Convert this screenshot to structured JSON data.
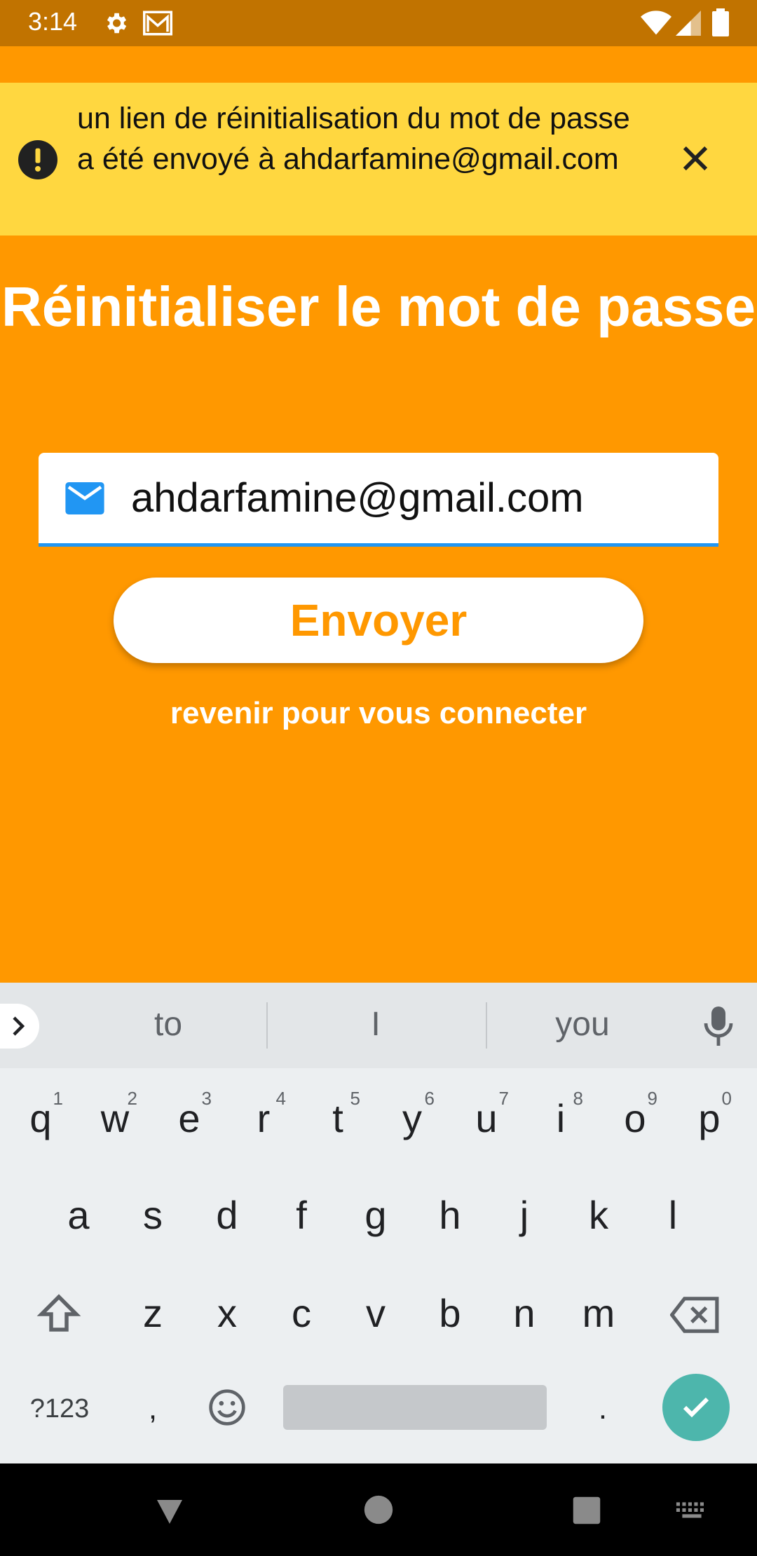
{
  "status_bar": {
    "time": "3:14"
  },
  "banner": {
    "message": "un lien de réinitialisation du mot de passe a été envoyé à ahdarfamine@gmail.com"
  },
  "title": "Réinitialiser le mot de passe",
  "email": {
    "value": "ahdarfamine@gmail.com"
  },
  "send_button": "Envoyer",
  "back_link": "revenir pour vous connecter",
  "keyboard": {
    "suggestions": [
      "to",
      "I",
      "you"
    ],
    "row1": [
      {
        "key": "q",
        "hint": "1"
      },
      {
        "key": "w",
        "hint": "2"
      },
      {
        "key": "e",
        "hint": "3"
      },
      {
        "key": "r",
        "hint": "4"
      },
      {
        "key": "t",
        "hint": "5"
      },
      {
        "key": "y",
        "hint": "6"
      },
      {
        "key": "u",
        "hint": "7"
      },
      {
        "key": "i",
        "hint": "8"
      },
      {
        "key": "o",
        "hint": "9"
      },
      {
        "key": "p",
        "hint": "0"
      }
    ],
    "row2": [
      "a",
      "s",
      "d",
      "f",
      "g",
      "h",
      "j",
      "k",
      "l"
    ],
    "row3": [
      "z",
      "x",
      "c",
      "v",
      "b",
      "n",
      "m"
    ],
    "symbols_key": "?123",
    "comma_key": ",",
    "period_key": "."
  },
  "colors": {
    "primary": "#FF9800",
    "status_bar": "#C17300",
    "banner": "#FFD740",
    "field_underline": "#2196F3",
    "enter_key": "#4DB6AC"
  }
}
